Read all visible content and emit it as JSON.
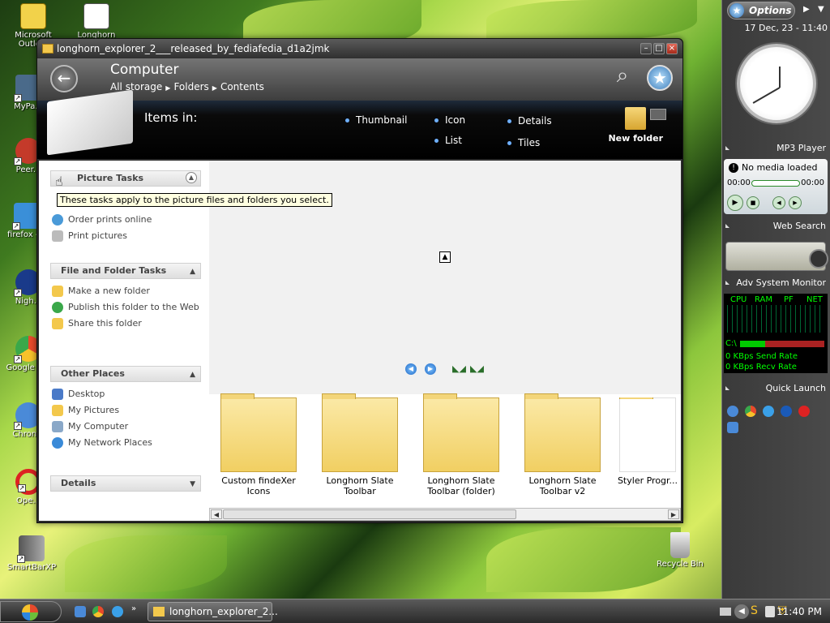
{
  "desktop": {
    "icons": [
      {
        "label": "Microsoft Outlo..."
      },
      {
        "label": "Longhorn"
      },
      {
        "label": "MyPa..."
      },
      {
        "label": "Peer..."
      },
      {
        "label": "firefox -..."
      },
      {
        "label": "Nigh..."
      },
      {
        "label": "Google C..."
      },
      {
        "label": "Chron..."
      },
      {
        "label": "Ope..."
      },
      {
        "label": "SmartBarXP"
      },
      {
        "label": "Recycle Bin"
      }
    ]
  },
  "window": {
    "title": "longhorn_explorer_2___released_by_fediafedia_d1a2jmk",
    "location_title": "Computer",
    "breadcrumb": [
      "All storage",
      "Folders",
      "Contents"
    ],
    "items_in_label": "Items in:",
    "views": [
      "Thumbnail",
      "Icon",
      "Details",
      "List",
      "Tiles"
    ],
    "new_folder_label": "New folder",
    "tooltip": "These tasks apply to the picture files and folders you select.",
    "panels": {
      "picture_tasks": {
        "title": "Picture Tasks",
        "items": [
          "Order prints online",
          "Print pictures"
        ]
      },
      "file_folder_tasks": {
        "title": "File and Folder Tasks",
        "items": [
          "Make a new folder",
          "Publish this folder to the Web",
          "Share this folder"
        ]
      },
      "other_places": {
        "title": "Other Places",
        "items": [
          "Desktop",
          "My Pictures",
          "My Computer",
          "My Network Places"
        ]
      },
      "details": {
        "title": "Details"
      }
    },
    "thumbnails": [
      "Custom findeXer Icons",
      "Longhorn Slate Toolbar",
      "Longhorn Slate Toolbar (folder)",
      "Longhorn Slate Toolbar v2",
      "Styler Progr..."
    ]
  },
  "sidebar": {
    "options_label": "Options",
    "date_time": "17 Dec, 23 - 11:40",
    "mp3_title": "MP3 Player",
    "mp3_status": "No media loaded",
    "mp3_time_start": "00:00",
    "mp3_time_end": "00:00",
    "web_search_title": "Web Search",
    "sysmon_title": "Adv System Monitor",
    "sysmon_cols": [
      "CPU",
      "RAM",
      "PF",
      "NET"
    ],
    "sysmon_drive": "C:\\",
    "sysmon_send": "0 KBps Send Rate",
    "sysmon_recv": "0 KBps Recv Rate",
    "quicklaunch_title": "Quick Launch"
  },
  "taskbar": {
    "task_label": "longhorn_explorer_2...",
    "clock": "11:40 PM"
  }
}
